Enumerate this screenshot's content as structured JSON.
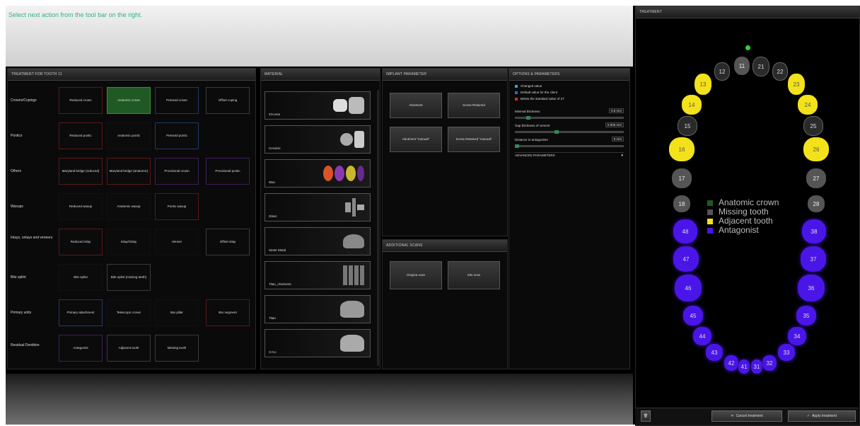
{
  "instruction": "Select next action from the tool bar on the right.",
  "treatment_panel": {
    "title": "TREATMENT FOR TOOTH 11",
    "rows": [
      {
        "label": "Crowns/Copings",
        "buttons": [
          "Reduced crown",
          "Anatomic crown",
          "Pressed crown",
          "Offset coping"
        ]
      },
      {
        "label": "Pontics",
        "buttons": [
          "Reduced pontic",
          "Anatomic pontic",
          "Pressed pontic"
        ]
      },
      {
        "label": "Others",
        "buttons": [
          "Maryland bridge (reduced)",
          "Maryland bridge (anatomic)",
          "Provisional crown",
          "Provisional pontic"
        ]
      },
      {
        "label": "Waxups",
        "buttons": [
          "Reduced waxup",
          "Anatomic waxup",
          "Pontic waxup"
        ]
      },
      {
        "label": "Inlays, onlays and veneers",
        "buttons": [
          "Reduced inlay",
          "Inlay/Onlay",
          "Veneer",
          "Offset inlay"
        ]
      },
      {
        "label": "Bite splint",
        "buttons": [
          "Bite splint",
          "Bite splint (missing teeth)"
        ]
      },
      {
        "label": "Primary units",
        "buttons": [
          "Primary attachment",
          "Telescopic crown",
          "Bar pillar",
          "Bar segment"
        ]
      },
      {
        "label": "Residual Dentition",
        "buttons": [
          "Antagonist",
          "Adjacent tooth",
          "Missing tooth"
        ]
      }
    ]
  },
  "material_panel": {
    "title": "MATERIAL",
    "items": [
      "Zirconia",
      "Ceramic",
      "Wax",
      "Glass",
      "Sinter Metal",
      "Titan_Abutment",
      "Titan",
      "CrCo"
    ]
  },
  "implant_panel": {
    "title": "IMPLANT PARAMETER",
    "buttons": [
      "Abutment",
      "Screw Retained",
      "Abutment \"manual\"",
      "Screw Retained \"manual\""
    ]
  },
  "scans_panel": {
    "title": "ADDITIONAL SCANS",
    "buttons": [
      "Gingiva scan",
      "Situ scan"
    ]
  },
  "options_panel": {
    "title": "OPTIONS & PARAMETERS",
    "legend": [
      "Changed value",
      "Default value for the client",
      "Below the standard value of 27"
    ],
    "legend_colors": [
      "#2aa8d8",
      "#2a6ad8",
      "#d82a2a"
    ],
    "params": [
      {
        "label": "Minimal thickness",
        "value": "0.5",
        "unit": "mm"
      },
      {
        "label": "Gap thickness of cement",
        "value": "0.005",
        "unit": "mm"
      },
      {
        "label": "Distance to antagonists",
        "value": "0",
        "unit": "mm"
      }
    ],
    "advanced": "ADVANCED PARAMETERS"
  },
  "tooth_chart": {
    "title": "TREATMENT",
    "legend": [
      {
        "label": "Anatomic crown",
        "color": "#1f5a24"
      },
      {
        "label": "Missing tooth",
        "color": "#555555"
      },
      {
        "label": "Adjacent tooth",
        "color": "#f3e21a"
      },
      {
        "label": "Antagonist",
        "color": "#4a16e8"
      }
    ],
    "teeth": {
      "t11": "11",
      "t21": "21",
      "t12": "12",
      "t22": "22",
      "t13": "13",
      "t23": "23",
      "t14": "14",
      "t24": "24",
      "t15": "15",
      "t25": "25",
      "t16": "16",
      "t26": "26",
      "t17": "17",
      "t27": "27",
      "t18": "18",
      "t28": "28",
      "t48": "48",
      "t38": "38",
      "t47": "47",
      "t37": "37",
      "t46": "46",
      "t36": "36",
      "t45": "45",
      "t35": "35",
      "t44": "44",
      "t34": "34",
      "t43": "43",
      "t33": "33",
      "t42": "42",
      "t32": "32",
      "t41": "41",
      "t31": "31"
    },
    "cancel": "Cancel treatment",
    "apply": "Apply treatment"
  }
}
